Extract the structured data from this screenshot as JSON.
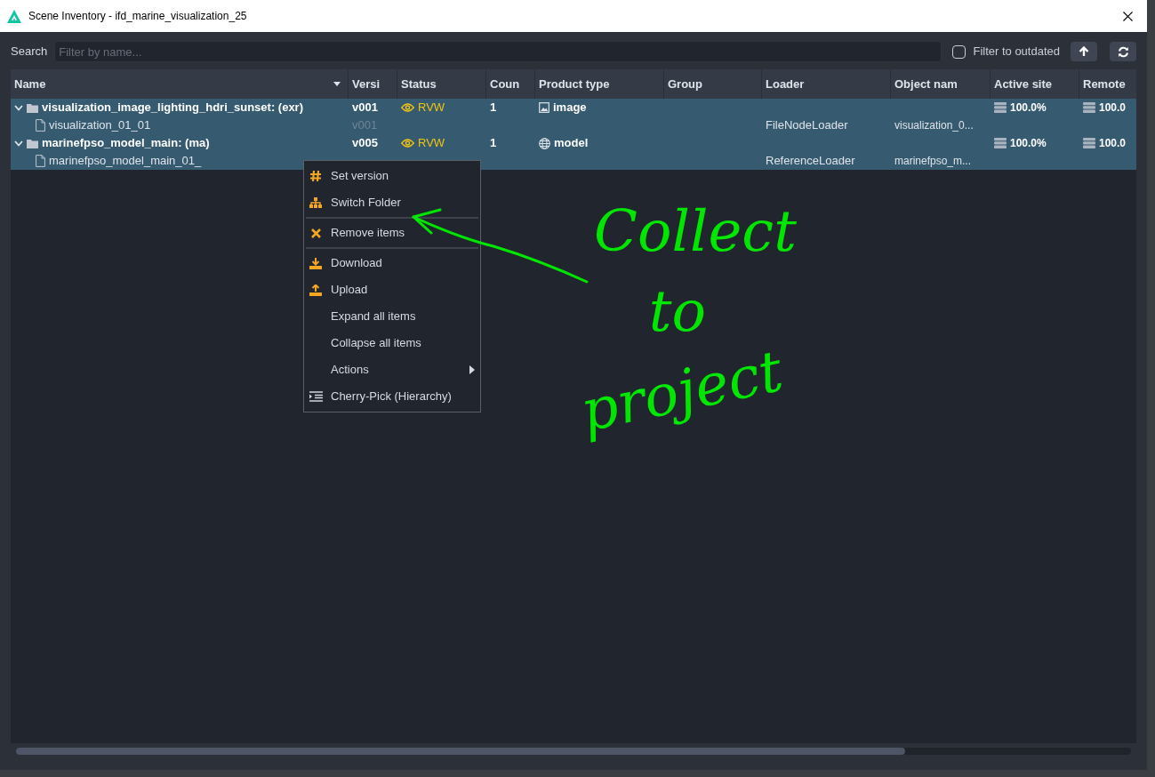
{
  "window": {
    "title": "Scene Inventory - ifd_marine_visualization_25"
  },
  "toolbar": {
    "search_label": "Search",
    "search": {
      "placeholder": "Filter by name..."
    },
    "filter_outdated": {
      "label": "Filter to outdated",
      "checked": false
    }
  },
  "table": {
    "columns": [
      "Name",
      "Versi",
      "Status",
      "Coun",
      "Product type",
      "Group",
      "Loader",
      "Object nam",
      "Active site",
      "Remote"
    ],
    "rows": [
      {
        "kind": "group",
        "selected": true,
        "expanded": true,
        "name": "visualization_image_lighting_hdri_sunset: (exr)",
        "version": "v001",
        "status": "RVW",
        "count": "1",
        "product": {
          "kind": "image",
          "label": "image"
        },
        "active_site": "100.0%",
        "remote_site": "100.0"
      },
      {
        "kind": "item",
        "selected": true,
        "name": "visualization_01_01",
        "version": "v001",
        "loader": "FileNodeLoader",
        "object_name": "visualization_0..."
      },
      {
        "kind": "group",
        "selected": true,
        "expanded": true,
        "name": "marinefpso_model_main: (ma)",
        "version": "v005",
        "status": "RVW",
        "count": "1",
        "product": {
          "kind": "model",
          "label": "model"
        },
        "active_site": "100.0%",
        "remote_site": "100.0"
      },
      {
        "kind": "item",
        "selected": true,
        "name": "marinefpso_model_main_01_",
        "loader": "ReferenceLoader",
        "object_name": "marinefpso_m..."
      }
    ]
  },
  "context_menu": {
    "items": [
      {
        "label": "Set version",
        "kind": "hash",
        "submenu": false
      },
      {
        "label": "Switch Folder",
        "kind": "hierarchy",
        "submenu": false
      },
      {
        "kind": "separator"
      },
      {
        "label": "Remove items",
        "kind": "cross",
        "submenu": false
      },
      {
        "kind": "separator"
      },
      {
        "label": "Download",
        "kind": "download",
        "submenu": false
      },
      {
        "label": "Upload",
        "kind": "upload",
        "submenu": false
      },
      {
        "label": "Expand all items",
        "kind": "plain",
        "submenu": false
      },
      {
        "label": "Collapse all items",
        "kind": "plain",
        "submenu": false
      },
      {
        "label": "Actions",
        "kind": "plain",
        "submenu": true
      },
      {
        "label": "Cherry-Pick (Hierarchy)",
        "kind": "list",
        "submenu": false
      }
    ]
  },
  "annotation": {
    "lines": [
      "Collect",
      "to",
      "project"
    ]
  }
}
